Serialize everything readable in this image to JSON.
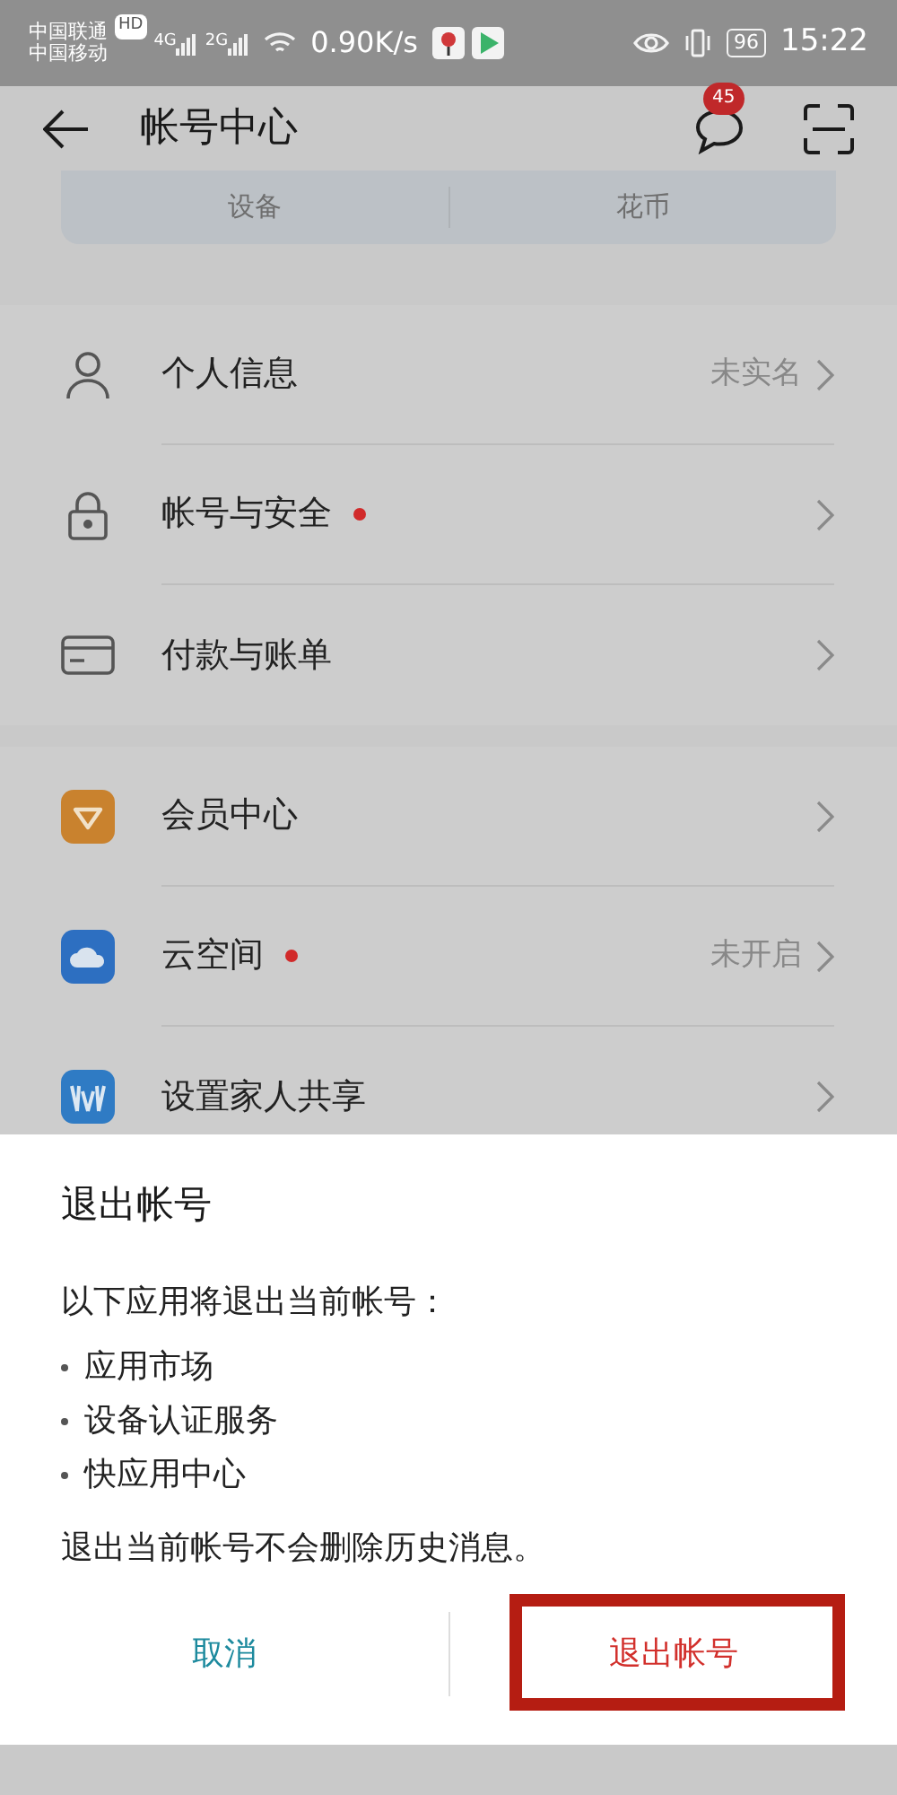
{
  "status_bar": {
    "carriers": [
      "中国联通",
      "中国移动"
    ],
    "hd": "HD",
    "signals": [
      "4G",
      "2G"
    ],
    "speed": "0.90K/s",
    "battery": "96",
    "time": "15:22"
  },
  "header": {
    "title": "帐号中心",
    "badge": "45"
  },
  "card_tabs": [
    "设备",
    "花币"
  ],
  "sections": [
    {
      "items": [
        {
          "label": "个人信息",
          "value": "未实名",
          "dot": false
        },
        {
          "label": "帐号与安全",
          "dot": true
        },
        {
          "label": "付款与账单",
          "dot": false
        }
      ]
    },
    {
      "items": [
        {
          "label": "会员中心",
          "dot": false
        },
        {
          "label": "云空间",
          "value": "未开启",
          "dot": true
        },
        {
          "label": "设置家人共享",
          "dot": false
        }
      ]
    }
  ],
  "dialog": {
    "title": "退出帐号",
    "intro": "以下应用将退出当前帐号：",
    "bullets": [
      "应用市场",
      "设备认证服务",
      "快应用中心"
    ],
    "note": "退出当前帐号不会删除历史消息。",
    "buttons": [
      {
        "label": "取消",
        "kind": "cancel",
        "highlighted": false
      },
      {
        "label": "退出帐号",
        "kind": "danger",
        "highlighted": true
      }
    ]
  }
}
